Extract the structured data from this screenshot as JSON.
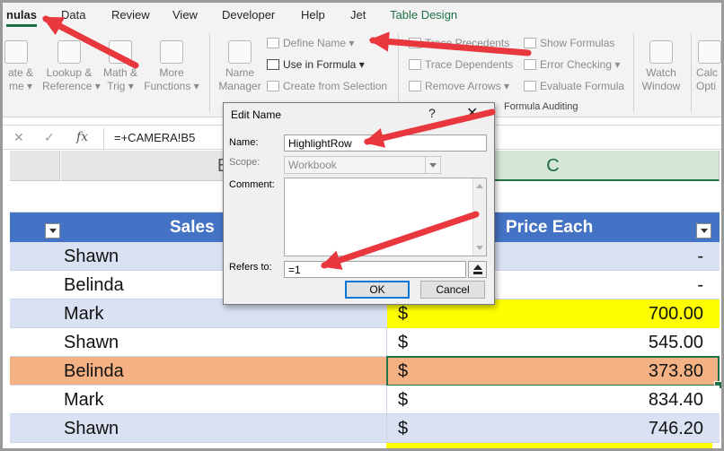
{
  "ribbon": {
    "tabs": [
      "nulas",
      "Data",
      "Review",
      "View",
      "Developer",
      "Help",
      "Jet",
      "Table Design"
    ],
    "active_tab": "nulas",
    "buttons": {
      "date_time": [
        "ate &",
        "me"
      ],
      "lookup": [
        "Lookup &",
        "Reference"
      ],
      "math": [
        "Math &",
        "Trig"
      ],
      "more": [
        "More",
        "Functions"
      ],
      "name_manager": [
        "Name",
        "Manager"
      ],
      "watch": [
        "Watch",
        "Window"
      ],
      "calc": [
        "Calc",
        "Opti"
      ]
    },
    "defined_names": {
      "define_name": "Define Name",
      "use_in_formula": "Use in Formula",
      "create_from_selection": "Create from Selection"
    },
    "auditing": {
      "trace_precedents": "Trace Precedents",
      "trace_dependents": "Trace Dependents",
      "remove_arrows": "Remove Arrows",
      "show_formulas": "Show Formulas",
      "error_checking": "Error Checking",
      "evaluate_formula": "Evaluate Formula",
      "group_label": "Formula Auditing"
    }
  },
  "formula_bar": {
    "cancel": "✕",
    "enter": "✓",
    "fx": "fx",
    "formula": "=+CAMERA!B5"
  },
  "sheet": {
    "col_b": "B",
    "col_c": "C",
    "header": {
      "sales": "Sales",
      "price_each": "Price Each"
    },
    "rows": [
      {
        "name": "Shawn",
        "dollar": "",
        "price": "-"
      },
      {
        "name": "Belinda",
        "dollar": "",
        "price": "-"
      },
      {
        "name": "Mark",
        "dollar": "$",
        "price": "700.00"
      },
      {
        "name": "Shawn",
        "dollar": "$",
        "price": "545.00"
      },
      {
        "name": "Belinda",
        "dollar": "$",
        "price": "373.80"
      },
      {
        "name": "Mark",
        "dollar": "$",
        "price": "834.40"
      },
      {
        "name": "Shawn",
        "dollar": "$",
        "price": "746.20"
      }
    ]
  },
  "dialog": {
    "title": "Edit Name",
    "help": "?",
    "close": "✕",
    "name_label": "Name:",
    "name_value": "HighlightRow",
    "scope_label": "Scope:",
    "scope_value": "Workbook",
    "comment_label": "Comment:",
    "refers_label": "Refers to:",
    "refers_value": "=1",
    "ok": "OK",
    "cancel": "Cancel"
  },
  "colors": {
    "table_header": "#4472c4",
    "band": "#d9e1f2",
    "highlight_row": "#f4b183",
    "yellow_cell": "#ffff00",
    "arrow": "#e8383d",
    "excel_green": "#217346"
  }
}
